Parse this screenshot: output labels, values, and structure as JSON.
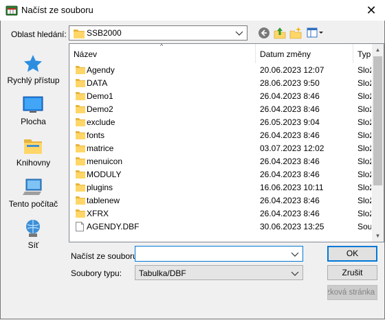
{
  "window": {
    "title": "Načíst ze souboru",
    "close_glyph": "✕"
  },
  "toolbar": {
    "lookin_label": "Oblast hledání:",
    "lookin_value": "SSB2000",
    "icons": [
      "back-icon",
      "up-folder-icon",
      "new-folder-icon",
      "view-menu-icon"
    ]
  },
  "places": [
    {
      "label": "Rychlý přístup",
      "icon": "quick-access-star-icon"
    },
    {
      "label": "Plocha",
      "icon": "desktop-icon"
    },
    {
      "label": "Knihovny",
      "icon": "libraries-icon"
    },
    {
      "label": "Tento počítač",
      "icon": "this-pc-icon"
    },
    {
      "label": "Síť",
      "icon": "network-icon"
    }
  ],
  "columns": {
    "name": "Název",
    "date": "Datum změny",
    "type": "Typ"
  },
  "files": [
    {
      "name": "Agendy",
      "date": "20.06.2023 12:07",
      "type": "Složka",
      "kind": "folder"
    },
    {
      "name": "DATA",
      "date": "28.06.2023 9:50",
      "type": "Složka",
      "kind": "folder"
    },
    {
      "name": "Demo1",
      "date": "26.04.2023 8:46",
      "type": "Složka",
      "kind": "folder"
    },
    {
      "name": "Demo2",
      "date": "26.04.2023 8:46",
      "type": "Složka",
      "kind": "folder"
    },
    {
      "name": "exclude",
      "date": "26.05.2023 9:04",
      "type": "Složka",
      "kind": "folder"
    },
    {
      "name": "fonts",
      "date": "26.04.2023 8:46",
      "type": "Složka",
      "kind": "folder"
    },
    {
      "name": "matrice",
      "date": "03.07.2023 12:02",
      "type": "Složka",
      "kind": "folder"
    },
    {
      "name": "menuicon",
      "date": "26.04.2023 8:46",
      "type": "Složka",
      "kind": "folder"
    },
    {
      "name": "MODULY",
      "date": "26.04.2023 8:46",
      "type": "Složka",
      "kind": "folder"
    },
    {
      "name": "plugins",
      "date": "16.06.2023 10:11",
      "type": "Složka",
      "kind": "folder"
    },
    {
      "name": "tablenew",
      "date": "26.04.2023 8:46",
      "type": "Složka",
      "kind": "folder"
    },
    {
      "name": "XFRX",
      "date": "26.04.2023 8:46",
      "type": "Složka",
      "kind": "folder"
    },
    {
      "name": "AGENDY.DBF",
      "date": "30.06.2023 13:25",
      "type": "Soubor",
      "kind": "file"
    }
  ],
  "form": {
    "filename_label": "Načíst ze souboru",
    "filename_value": "",
    "filetype_label": "Soubory typu:",
    "filetype_value": "Tabulka/DBF"
  },
  "buttons": {
    "ok": "OK",
    "cancel": "Zrušit",
    "extra": "Ukázková stránka"
  },
  "colors": {
    "accent": "#0078d7",
    "folder": "#ffd667",
    "folder_dark": "#e8b43c"
  }
}
